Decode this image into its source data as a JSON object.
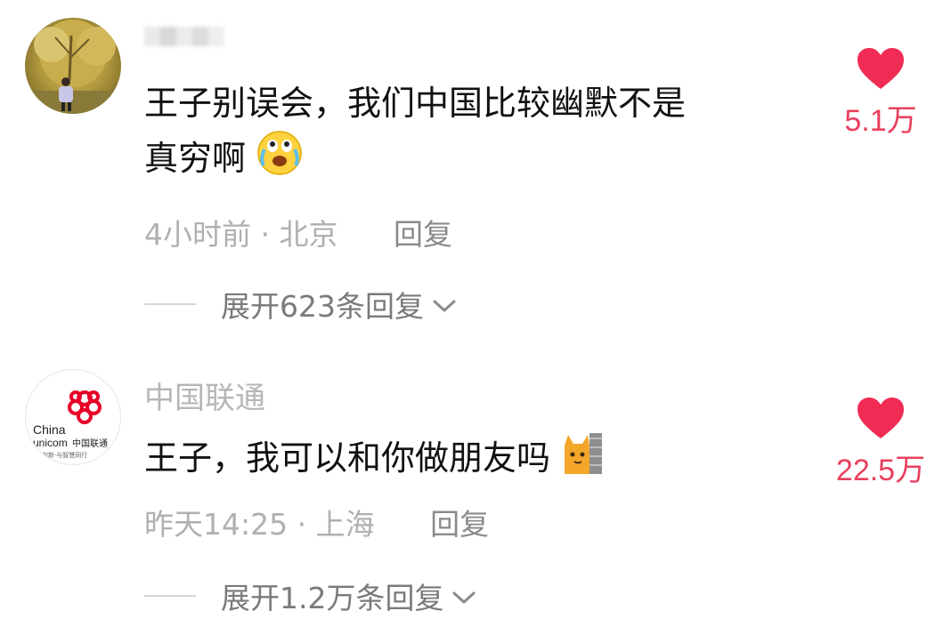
{
  "comments": [
    {
      "username": "",
      "text_line1": "王子别误会，我们中国比较幽默不是",
      "text_line2": "真穷啊",
      "emoji": "crying-laughing-emoji",
      "time": "4小时前",
      "location": "北京",
      "reply_label": "回复",
      "expand_label": "展开623条回复",
      "like_count": "5.1万",
      "liked": true
    },
    {
      "username": "中国联通",
      "avatar_logo_text": "China unicom中国联通 创新·与智慧同行",
      "text_line1": "王子，我可以和你做朋友吗",
      "emoji": "cat-peeking-emoji",
      "time": "昨天14:25",
      "location": "上海",
      "reply_label": "回复",
      "expand_label": "展开1.2万条回复",
      "like_count": "22.5万",
      "liked": true
    }
  ],
  "separator": " · ",
  "colors": {
    "like_red": "#e8405e",
    "meta_gray": "#b0b0b0",
    "text_black": "#111111"
  }
}
